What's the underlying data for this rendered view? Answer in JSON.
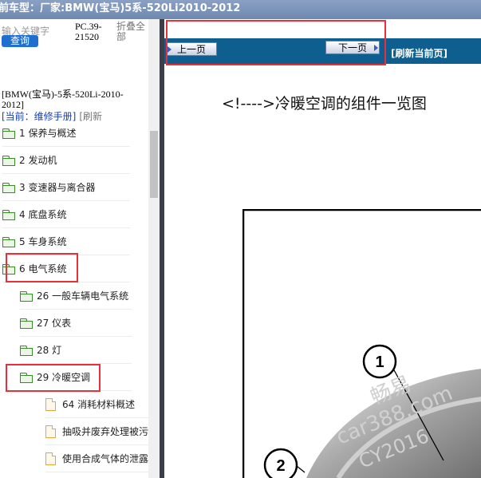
{
  "titlebar": {
    "text": "前车型：厂家:BMW(宝马)5系-520Li2010-2012"
  },
  "search": {
    "placeholder": "输入关键字",
    "button": "查询",
    "pc_code": "PC.39-21520",
    "collapse_all": "折叠全部"
  },
  "breadcrumb": {
    "path": "[BMW(宝马)-5系-520Li-2010-2012]",
    "current": "[当前：维修手册]",
    "refresh": "[刷新"
  },
  "tree": [
    {
      "label": "1 保养与概述",
      "type": "folder"
    },
    {
      "label": "2 发动机",
      "type": "folder"
    },
    {
      "label": "3 变速器与离合器",
      "type": "folder"
    },
    {
      "label": "4 底盘系统",
      "type": "folder"
    },
    {
      "label": "5 车身系统",
      "type": "folder"
    },
    {
      "label": "6 电气系统",
      "type": "folder"
    },
    {
      "label": "26 一般车辆电气系统",
      "type": "folder"
    },
    {
      "label": "27 仪表",
      "type": "folder"
    },
    {
      "label": "28 灯",
      "type": "folder"
    },
    {
      "label": "29 冷暖空调",
      "type": "folder"
    },
    {
      "label": "64 消耗材料概述",
      "type": "doc"
    },
    {
      "label": "抽吸并废弃处理被污",
      "type": "doc"
    },
    {
      "label": "使用合成气体的泄露",
      "type": "doc"
    }
  ],
  "nav": {
    "prev": "上一页",
    "next": "下一页",
    "refresh_page": "[刷新当前页]"
  },
  "content": {
    "title": "<!---->冷暖空调的组件一览图",
    "callouts": [
      "1",
      "2"
    ],
    "watermark": [
      "畅易",
      "car388.com",
      "CY2016"
    ]
  },
  "colors": {
    "highlight": "#e8303a",
    "nav_bg": "#0e5f8f",
    "query_button": "#1f6fd1"
  }
}
